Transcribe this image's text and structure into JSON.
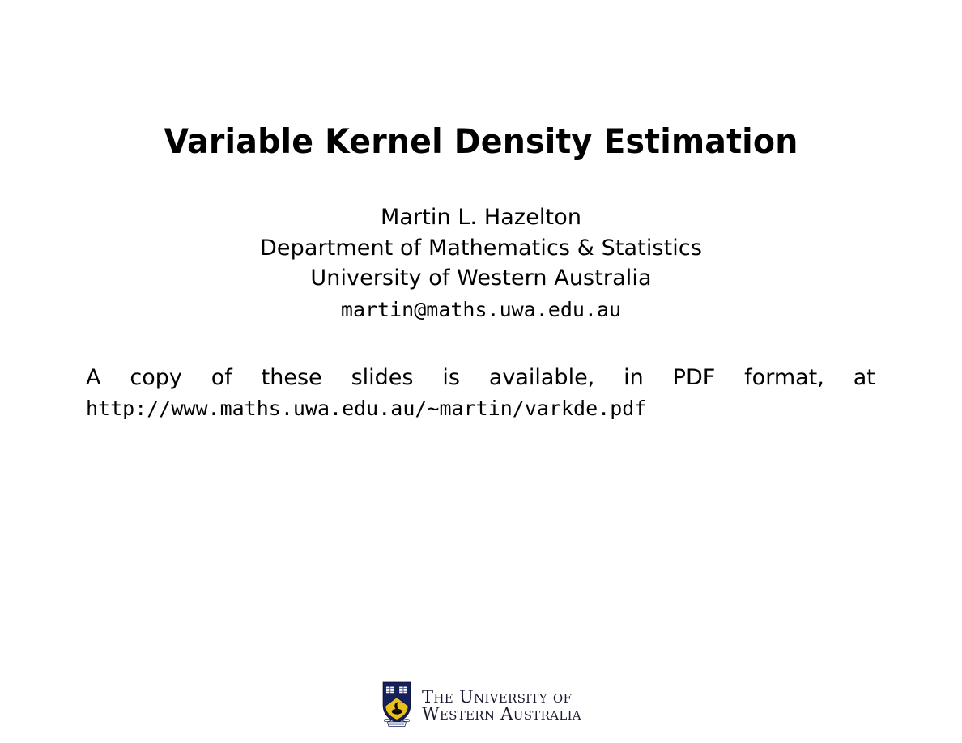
{
  "page": {
    "background_color": "#ffffff",
    "text_color": "#000000"
  },
  "title": "Variable Kernel Density Estimation",
  "author": {
    "name": "Martin L. Hazelton",
    "department": "Department of Mathematics & Statistics",
    "institution": "University of Western Australia",
    "email": "martin@maths.uwa.edu.au"
  },
  "body": {
    "line1_words": [
      "A",
      "copy",
      "of",
      "these",
      "slides",
      "is",
      "available,",
      "in",
      "PDF",
      "format,",
      "at"
    ],
    "url": "http://www.maths.uwa.edu.au/~martin/varkde.pdf"
  },
  "footer": {
    "logo_line1": "The University of",
    "logo_line2": "Western Australia",
    "crest_colors": {
      "navy": "#16215c",
      "gold": "#e8c01c",
      "white": "#ffffff",
      "black": "#000000"
    }
  }
}
